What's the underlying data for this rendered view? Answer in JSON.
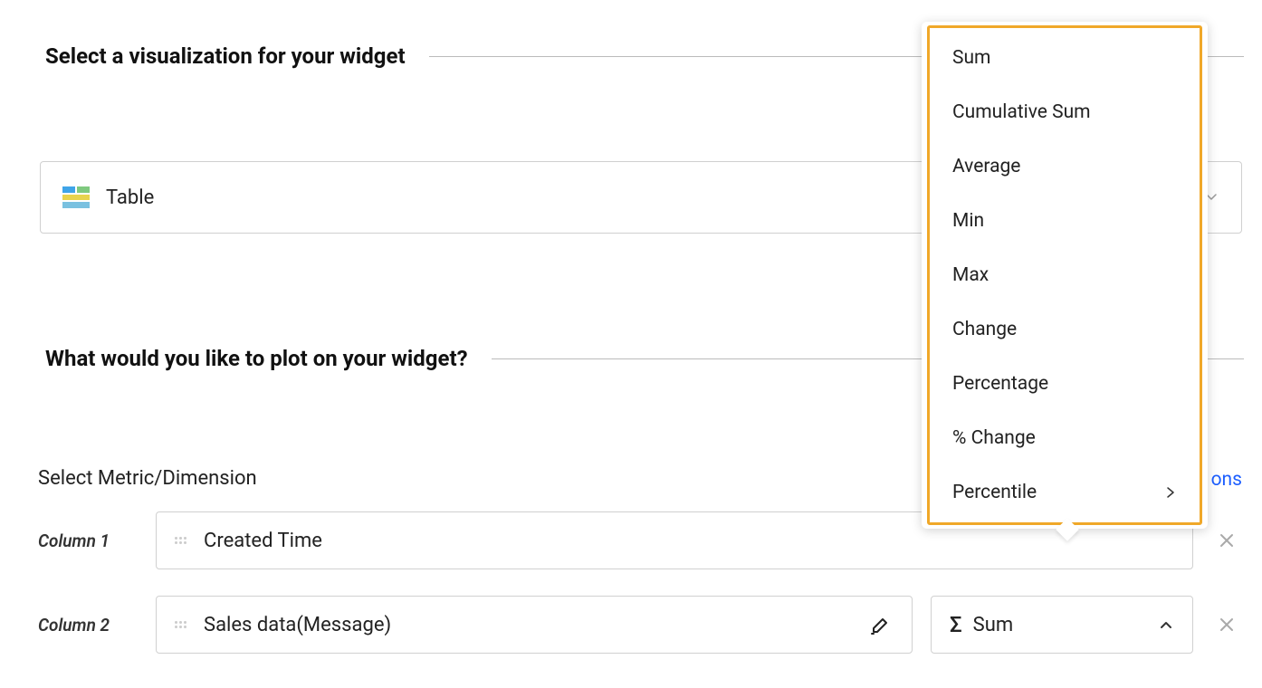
{
  "section1": {
    "title": "Select a visualization for your widget",
    "viz_type": "Table"
  },
  "section2": {
    "title": "What would you like to plot on your widget?"
  },
  "metric_label": "Select Metric/Dimension",
  "actions_link_suffix": "ons",
  "columns": [
    {
      "label": "Column 1",
      "field": "Created Time"
    },
    {
      "label": "Column 2",
      "field": "Sales data(Message)",
      "aggregation": "Sum"
    }
  ],
  "dropdown_options": [
    "Sum",
    "Cumulative Sum",
    "Average",
    "Min",
    "Max",
    "Change",
    "Percentage",
    "% Change",
    "Percentile"
  ],
  "colors": {
    "highlight": "#f0a829",
    "link": "#1d5fff"
  }
}
